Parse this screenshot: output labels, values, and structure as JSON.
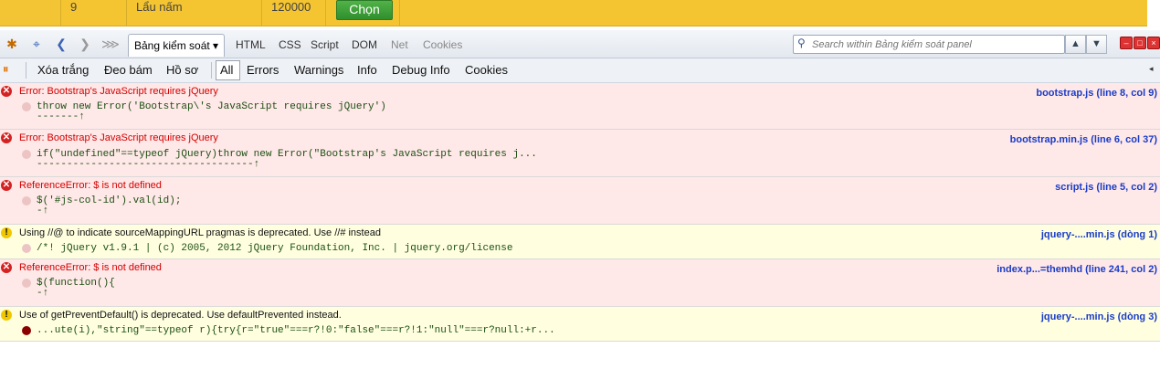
{
  "page_row": {
    "index": "9",
    "name": "Lẩu nấm",
    "price": "120000",
    "button": "Chọn"
  },
  "toolbar": {
    "tabs": [
      "Bảng kiểm soát ▾",
      "HTML",
      "CSS",
      "Script",
      "DOM",
      "Net",
      "Cookies"
    ],
    "search_placeholder": "Search within Bảng kiểm soát panel"
  },
  "console_toolbar": {
    "items": [
      "Xóa trắng",
      "Đeo bám",
      "Hồ sơ",
      "All",
      "Errors",
      "Warnings",
      "Info",
      "Debug Info",
      "Cookies"
    ]
  },
  "log": [
    {
      "level": "error",
      "message": "Error: Bootstrap's JavaScript requires jQuery",
      "source": "bootstrap.js (line 8, col 9)",
      "code": "throw new Error('Bootstrap\\'s JavaScript requires jQuery')",
      "pointer": "-------↑"
    },
    {
      "level": "error",
      "message": "Error: Bootstrap's JavaScript requires jQuery",
      "source": "bootstrap.min.js (line 6, col 37)",
      "code": "if(\"undefined\"==typeof jQuery)throw new Error(\"Bootstrap's JavaScript requires j...",
      "pointer": "------------------------------------↑"
    },
    {
      "level": "error",
      "message": "ReferenceError: $ is not defined",
      "source": "script.js (line 5, col 2)",
      "code": "$('#js-col-id').val(id);",
      "pointer": "-↑"
    },
    {
      "level": "warning",
      "message": "Using //@ to indicate sourceMappingURL pragmas is deprecated. Use //# instead",
      "source": "jquery-....min.js (dòng 1)",
      "code": "/*! jQuery v1.9.1 | (c) 2005, 2012 jQuery Foundation, Inc. | jquery.org/license",
      "pointer": ""
    },
    {
      "level": "error",
      "message": "ReferenceError: $ is not defined",
      "source": "index.p...=themhd (line 241, col 2)",
      "code": "$(function(){",
      "pointer": "-↑"
    },
    {
      "level": "warning",
      "message": "Use of getPreventDefault() is deprecated.  Use defaultPrevented instead.",
      "source": "jquery-....min.js (dòng 3)",
      "code": "...ute(i),\"string\"==typeof r){try{r=\"true\"===r?!0:\"false\"===r?!1:\"null\"===r?null:+r...",
      "pointer": ""
    }
  ]
}
